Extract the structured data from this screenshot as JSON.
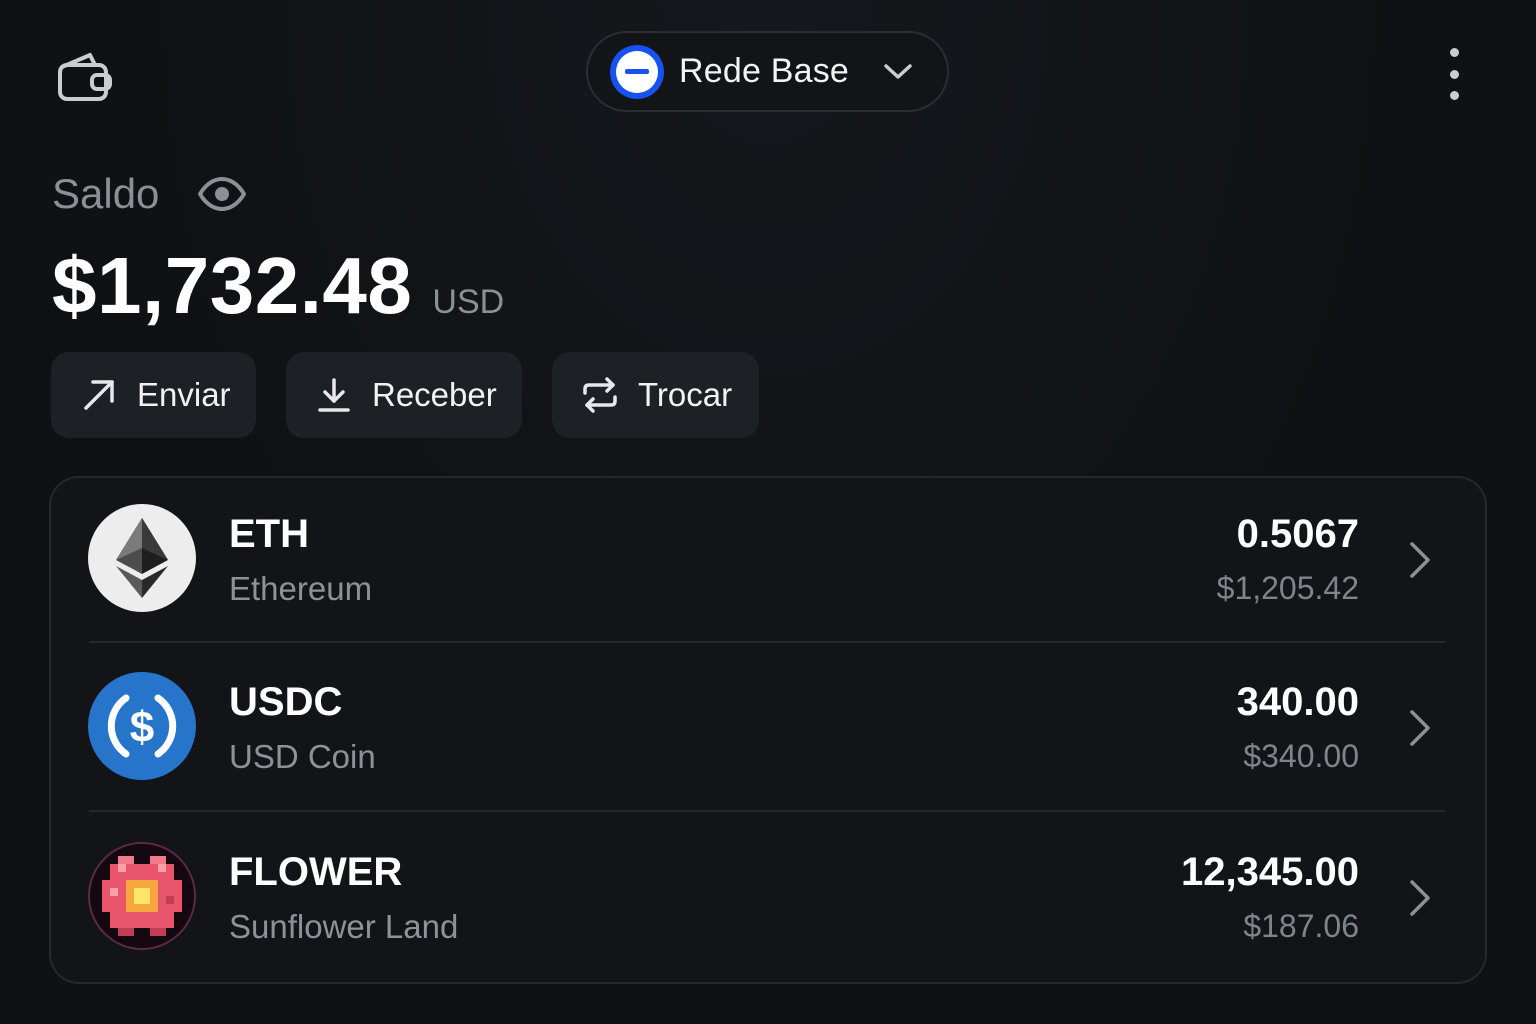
{
  "network": {
    "name": "Rede Base",
    "accent": "#1652f0"
  },
  "balance": {
    "label": "Saldo",
    "amount": "$1,732.48",
    "currency": "USD"
  },
  "actions": [
    {
      "label": "Enviar",
      "icon": "arrow-up-right-icon"
    },
    {
      "label": "Receber",
      "icon": "download-icon"
    },
    {
      "label": "Trocar",
      "icon": "swap-icon"
    }
  ],
  "assets": [
    {
      "symbol": "ETH",
      "name": "Ethereum",
      "amount": "0.5067",
      "fiat": "$1,205.42",
      "icon": "ethereum-icon"
    },
    {
      "symbol": "USDC",
      "name": "USD Coin",
      "amount": "340.00",
      "fiat": "$340.00",
      "icon": "usdc-icon",
      "color": "#2775ca"
    },
    {
      "symbol": "FLOWER",
      "name": "Sunflower Land",
      "amount": "12,345.00",
      "fiat": "$187.06",
      "icon": "flower-icon"
    }
  ]
}
